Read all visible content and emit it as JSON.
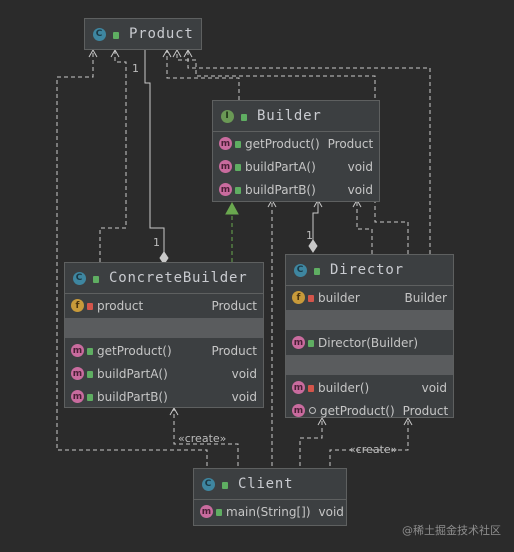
{
  "classes": {
    "product": {
      "name": "Product"
    },
    "builder": {
      "name": "Builder",
      "methods": [
        {
          "name": "getProduct()",
          "type": "Product"
        },
        {
          "name": "buildPartA()",
          "type": "void"
        },
        {
          "name": "buildPartB()",
          "type": "void"
        }
      ]
    },
    "concrete": {
      "name": "ConcreteBuilder",
      "fields": [
        {
          "name": "product",
          "type": "Product"
        }
      ],
      "methods": [
        {
          "name": "getProduct()",
          "type": "Product"
        },
        {
          "name": "buildPartA()",
          "type": "void"
        },
        {
          "name": "buildPartB()",
          "type": "void"
        }
      ]
    },
    "director": {
      "name": "Director",
      "fields": [
        {
          "name": "builder",
          "type": "Builder"
        }
      ],
      "constructors": [
        {
          "name": "Director(Builder)",
          "type": ""
        }
      ],
      "methods": [
        {
          "name": "builder()",
          "type": "void"
        },
        {
          "name": "getProduct()",
          "type": "Product"
        }
      ]
    },
    "client": {
      "name": "Client",
      "methods": [
        {
          "name": "main(String[])",
          "type": "void"
        }
      ]
    }
  },
  "labels": {
    "mult_product_concrete_top": "1",
    "mult_product_concrete_bottom": "1",
    "mult_builder_director": "1",
    "create_left": "«create»",
    "create_right": "«create»"
  },
  "badges": {
    "class": "C",
    "interface": "I",
    "method": "m",
    "field": "f"
  },
  "watermark": "@稀土掘金技术社区",
  "colors": {
    "background": "#2b2b2b",
    "node": "#3c3f41",
    "edge": "#c8c8c8",
    "realization": "#6aa84f"
  }
}
